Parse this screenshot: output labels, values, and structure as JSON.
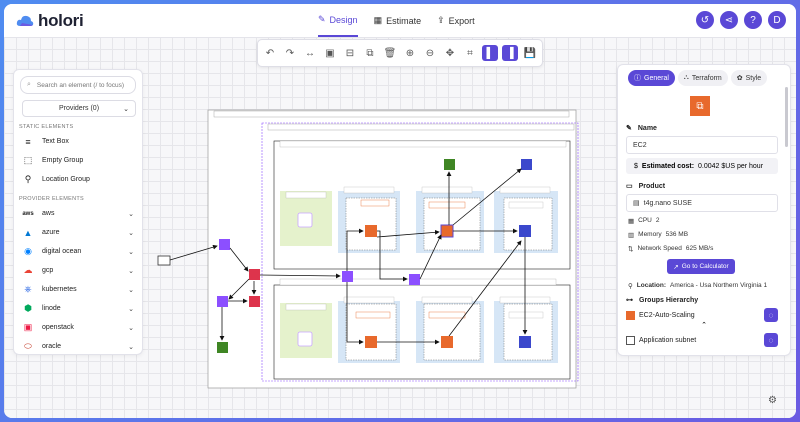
{
  "app": {
    "name": "holori"
  },
  "tabs": [
    {
      "label": "Design",
      "icon": "design-icon",
      "active": true
    },
    {
      "label": "Estimate",
      "icon": "calculator-icon",
      "active": false
    },
    {
      "label": "Export",
      "icon": "export-icon",
      "active": false
    }
  ],
  "user": {
    "initial": "D"
  },
  "left_panel": {
    "search_placeholder": "Search an element (/ to focus)",
    "providers_label": "Providers (0)",
    "static_header": "STATIC ELEMENTS",
    "static_items": [
      "Text Box",
      "Empty Group",
      "Location Group"
    ],
    "provider_header": "PROVIDER ELEMENTS",
    "provider_items": [
      "aws",
      "azure",
      "digital ocean",
      "gcp",
      "kubernetes",
      "linode",
      "openstack",
      "oracle"
    ]
  },
  "right_panel": {
    "tabs": [
      "General",
      "Terraform",
      "Style"
    ],
    "name_label": "Name",
    "name_value": "EC2",
    "cost_label": "Estimated cost:",
    "cost_value": "0.0042 $US per hour",
    "product_label": "Product",
    "product_value": "t4g.nano SUSE",
    "cpu_label": "CPU",
    "cpu_value": "2",
    "memory_label": "Memory",
    "memory_value": "536 MB",
    "network_label": "Network Speed",
    "network_value": "625 MB/s",
    "calc_button": "Go to Calculator",
    "location_label": "Location:",
    "location_value": "America - Usa Northern Virginia 1",
    "groups_label": "Groups Hierarchy",
    "group_items": [
      "EC2-Auto-Scaling",
      "Application subnet"
    ]
  },
  "colors": {
    "accent": "#5a48d6",
    "aws_orange": "#e8692c",
    "purple": "#8c4fff",
    "green": "#3f8624",
    "red": "#dd344c",
    "blue": "#3b48cc"
  }
}
